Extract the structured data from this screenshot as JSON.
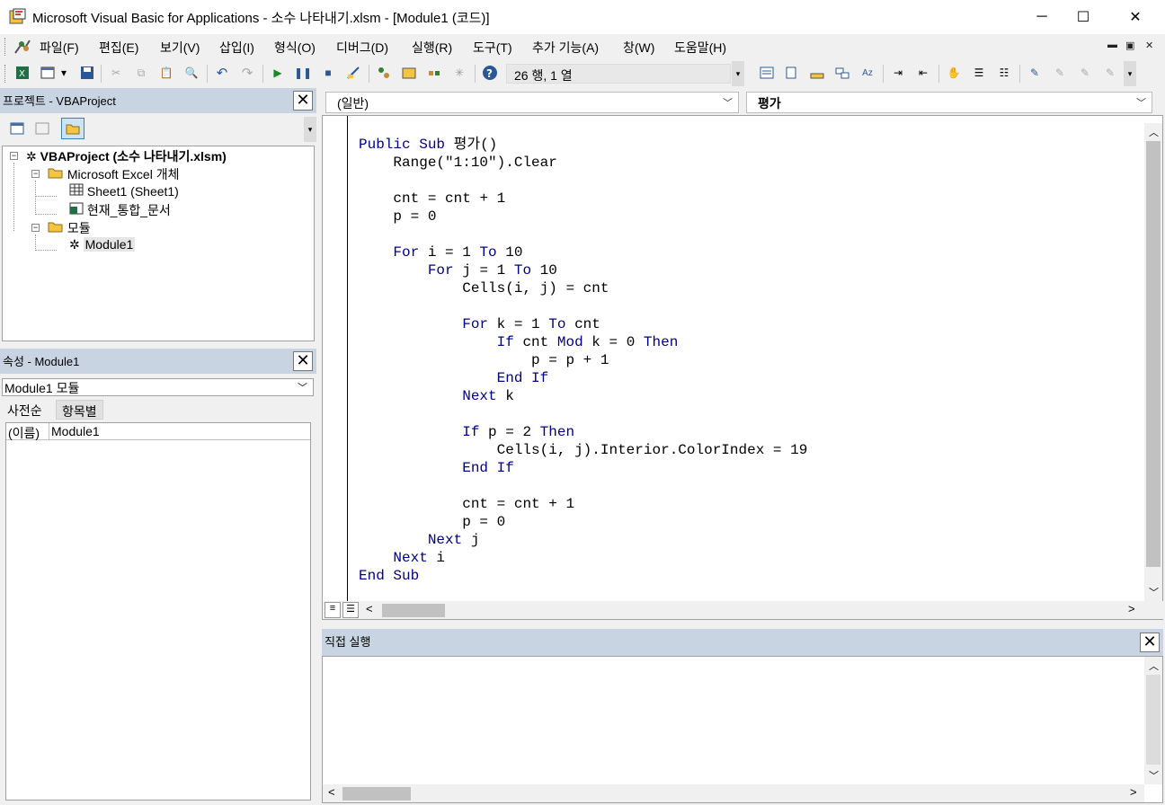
{
  "window": {
    "title": "Microsoft Visual Basic for Applications - 소수 나타내기.xlsm - [Module1 (코드)]",
    "minimize": "─",
    "maximize": "☐",
    "close": "✕"
  },
  "menu": {
    "items": [
      "파일(F)",
      "편집(E)",
      "보기(V)",
      "삽입(I)",
      "형식(O)",
      "디버그(D)",
      "실행(R)",
      "도구(T)",
      "추가 기능(A)",
      "창(W)",
      "도움말(H)"
    ],
    "mdi_min": "▬",
    "mdi_restore": "▣",
    "mdi_close": "✕"
  },
  "toolbar": {
    "cursor_position": "26 행, 1 열",
    "icons": [
      "excel-icon",
      "insert-module-icon",
      "save-icon",
      "cut-icon",
      "copy-icon",
      "paste-icon",
      "find-icon",
      "undo-icon",
      "redo-icon",
      "run-icon",
      "break-icon",
      "reset-icon",
      "design-mode-icon",
      "project-explorer-icon",
      "properties-icon",
      "object-browser-icon",
      "toolbox-icon",
      "help-icon"
    ]
  },
  "project_panel": {
    "title": "프로젝트 - VBAProject",
    "tree": {
      "root": "VBAProject (소수 나타내기.xlsm)",
      "folder1": "Microsoft Excel 개체",
      "sheet1": "Sheet1 (Sheet1)",
      "workbook": "현재_통합_문서",
      "folder2": "모듈",
      "module1": "Module1"
    }
  },
  "properties_panel": {
    "title": "속성 - Module1",
    "object_select": "Module1 모듈",
    "tabs": [
      "사전순",
      "항목별"
    ],
    "rows": [
      {
        "name": "(이름)",
        "value": "Module1"
      }
    ]
  },
  "code_window": {
    "object_combo": "(일반)",
    "procedure_combo": "평가",
    "lines": [
      "Public Sub 평가()",
      "    Range(\"1:10\").Clear",
      "",
      "    cnt = cnt + 1",
      "    p = 0",
      "",
      "    For i = 1 To 10",
      "        For j = 1 To 10",
      "            Cells(i, j) = cnt",
      "",
      "            For k = 1 To cnt",
      "                If cnt Mod k = 0 Then",
      "                    p = p + 1",
      "                End If",
      "            Next k",
      "",
      "            If p = 2 Then",
      "                Cells(i, j).Interior.ColorIndex = 19",
      "            End If",
      "",
      "            cnt = cnt + 1",
      "            p = 0",
      "        Next j",
      "    Next i",
      "End Sub"
    ]
  },
  "immediate_panel": {
    "title": "직접 실행"
  }
}
